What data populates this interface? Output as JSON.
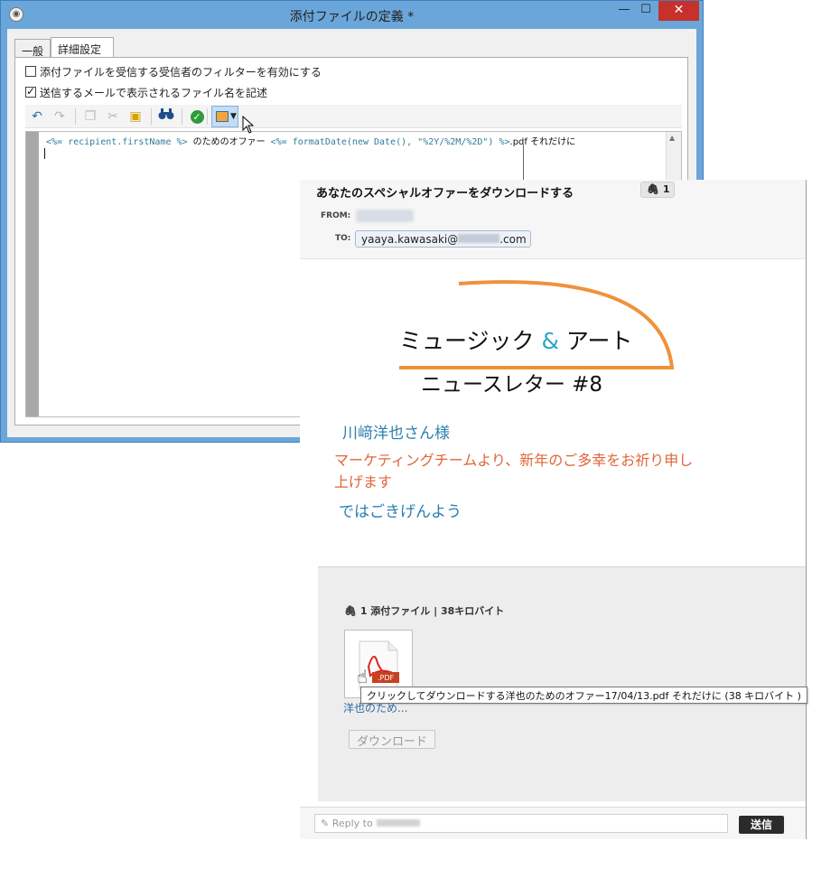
{
  "window": {
    "title": "添付ファイルの定義 *",
    "app_icon": "app-icon",
    "controls": {
      "minimize": "—",
      "maximize": "☐",
      "close": "✕"
    }
  },
  "tabs": [
    {
      "label": "一般",
      "active": false
    },
    {
      "label": "詳細設定",
      "active": true
    }
  ],
  "options": {
    "filter_checkbox": {
      "label": "添付ファイルを受信する受信者のフィルターを有効にする",
      "checked": false
    },
    "filename_checkbox": {
      "label": "送信するメールで表示されるファイル名を記述",
      "checked": true
    }
  },
  "toolbar": {
    "icons": [
      "undo-icon",
      "redo-icon",
      "copy-icon",
      "cut-icon",
      "paste-icon",
      "find-icon",
      "check-icon",
      "insert-field-icon"
    ]
  },
  "editor": {
    "code_tag1": "<%= recipient.firstName %>",
    "code_text1": "のためのオファー",
    "code_tag2": "<%= formatDate(new Date(), \"%2Y/%2M/%2D\") %>",
    "code_text2": ".pdf それだけに"
  },
  "email": {
    "subject": "あなたのスペシャルオファーをダウンロードする",
    "attachment_count": "1",
    "from_label": "FROM:",
    "to_label": "TO:",
    "to_prefix": "yaaya.kawasaki@",
    "to_suffix": ".com",
    "logo_line1_a": "ミュージック ",
    "logo_amp": "&",
    "logo_line1_b": " アート",
    "logo_line2": "ニュースレター #8",
    "greeting": "川﨑洋也さん様",
    "message": "マーケティングチームより、新年のご多幸をお祈り申し上げます",
    "closing": "ではごきげんよう",
    "attachments_summary_count": "1 添付ファイル",
    "attachments_summary_size": "38キロバイト",
    "file_label": "洋也のため...",
    "download_button": "ダウンロード",
    "tooltip": "クリックしてダウンロードする洋也のためのオファー17/04/13.pdf それだけに (38 キロバイト )",
    "reply_placeholder": "Reply to",
    "send_button": "送信"
  },
  "colors": {
    "titlebar": "#6aa6d9",
    "close_button": "#c7312b",
    "logo_orange": "#f0913a",
    "logo_teal": "#2aa6c9",
    "greeting_blue": "#2a7fb0",
    "message_orange": "#e0663a"
  }
}
